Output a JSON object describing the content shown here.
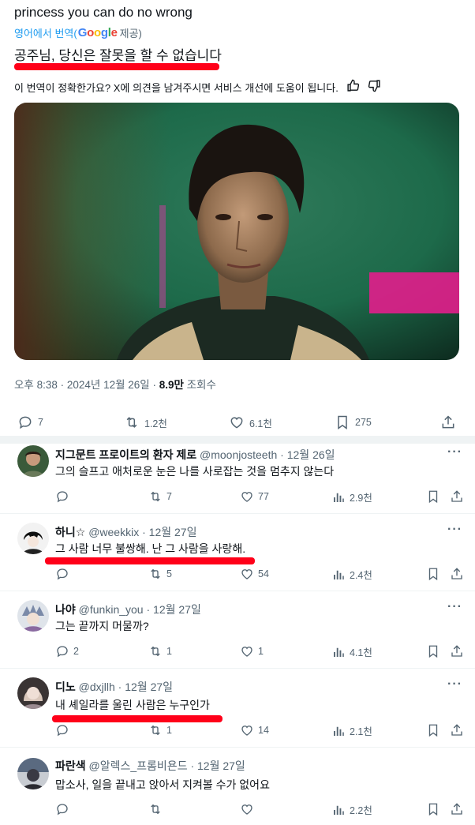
{
  "tweet": {
    "original_text": "princess you can do no wrong",
    "translate_prefix": "영어에서 번역(",
    "google_logo": "Google",
    "translate_suffix": "제공)",
    "translated_text": "공주님, 당신은 잘못을 할 수 없습니다",
    "feedback_text": "이 번역이 정확한가요? X에 의견을 남겨주시면 서비스 개선에 도움이 됩니다.",
    "time": "오후 8:38 · 2024년 12월 26일 · ",
    "views_count": "8.9만",
    "views_label": " 조회수",
    "stats": {
      "replies": "7",
      "retweets": "1.2천",
      "likes": "6.1천",
      "bookmarks": "275"
    }
  },
  "replies": [
    {
      "name": "지그문트 프로이트의 환자 제로",
      "handle": "@moonjosteeth",
      "date": "· 12월 26일",
      "text": "그의 슬프고 애처로운 눈은 나를 사로잡는 것을 멈추지 않는다",
      "replies": "",
      "retweets": "7",
      "likes": "77",
      "views": "2.9천"
    },
    {
      "name": "하니☆",
      "handle": "@weekkix",
      "date": "· 12월 27일",
      "text": "그 사람 너무 불쌍해. 난 그 사람을 사랑해.",
      "replies": "",
      "retweets": "5",
      "likes": "54",
      "views": "2.4천"
    },
    {
      "name": "나야",
      "handle": "@funkin_you",
      "date": "· 12월 27일",
      "text": "그는 끝까지 머물까?",
      "replies": "2",
      "retweets": "1",
      "likes": "1",
      "views": "4.1천"
    },
    {
      "name": "디노",
      "handle": "@dxjllh",
      "date": "· 12월 27일",
      "text": "내 셰일라를 울린 사람은 누구인가",
      "replies": "",
      "retweets": "1",
      "likes": "14",
      "views": "2.1천"
    },
    {
      "name": "파란색",
      "handle": "@알렉스_프롬비욘드",
      "date": "· 12월 27일",
      "text": "맙소사, 일을 끝내고 앉아서 지켜볼 수가 없어요",
      "replies": "",
      "retweets": "",
      "likes": "",
      "views": "2.2천"
    }
  ],
  "colors": {
    "accent": "#1d9bf0",
    "muted": "#536471",
    "marker": "#ff0019"
  },
  "icons": [
    "reply-icon",
    "retweet-icon",
    "like-icon",
    "bookmark-icon",
    "share-icon",
    "views-icon",
    "thumbs-up-icon",
    "thumbs-down-icon",
    "more-icon"
  ]
}
